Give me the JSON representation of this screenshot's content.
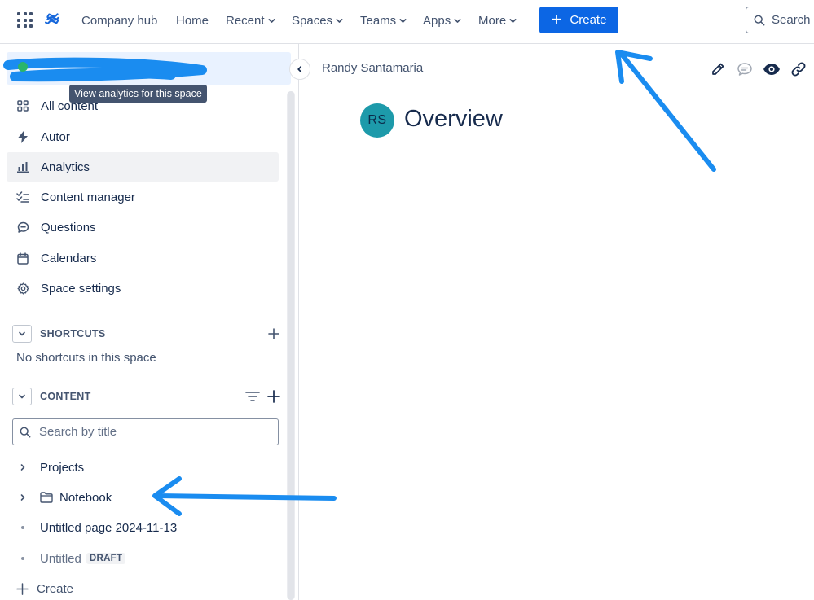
{
  "topnav": {
    "items": [
      {
        "label": "Company hub",
        "dropdown": false
      },
      {
        "label": "Home",
        "dropdown": false
      },
      {
        "label": "Recent",
        "dropdown": true
      },
      {
        "label": "Spaces",
        "dropdown": true
      },
      {
        "label": "Teams",
        "dropdown": true
      },
      {
        "label": "Apps",
        "dropdown": true
      },
      {
        "label": "More",
        "dropdown": true
      }
    ],
    "create_label": "Create",
    "search_placeholder": "Search"
  },
  "sidebar": {
    "menu": [
      {
        "label": "All content",
        "icon": "grid-icon"
      },
      {
        "label": "Autor",
        "icon": "lightning-icon"
      },
      {
        "label": "Analytics",
        "icon": "bar-chart-icon",
        "active": true
      },
      {
        "label": "Content manager",
        "icon": "checklist-icon"
      },
      {
        "label": "Questions",
        "icon": "chat-bubble-icon"
      },
      {
        "label": "Calendars",
        "icon": "calendar-icon"
      },
      {
        "label": "Space settings",
        "icon": "gear-icon"
      }
    ],
    "tooltip": "View analytics for this space",
    "shortcuts": {
      "title": "SHORTCUTS",
      "empty": "No shortcuts in this space"
    },
    "content": {
      "title": "CONTENT",
      "search_placeholder": "Search by title",
      "tree": [
        {
          "label": "Projects",
          "kind": "expandable"
        },
        {
          "label": "Notebook",
          "kind": "folder"
        },
        {
          "label": "Untitled page 2024-11-13",
          "kind": "page"
        },
        {
          "label": "Untitled",
          "kind": "draft",
          "badge": "DRAFT"
        }
      ]
    },
    "create_label": "Create"
  },
  "main": {
    "author": "Randy Santamaria",
    "avatar_initials": "RS",
    "title": "Overview"
  },
  "colors": {
    "primary": "#0c66e4",
    "avatar": "#1d9aaa",
    "annotation": "#1a8cf0",
    "text": "#172b4d"
  }
}
